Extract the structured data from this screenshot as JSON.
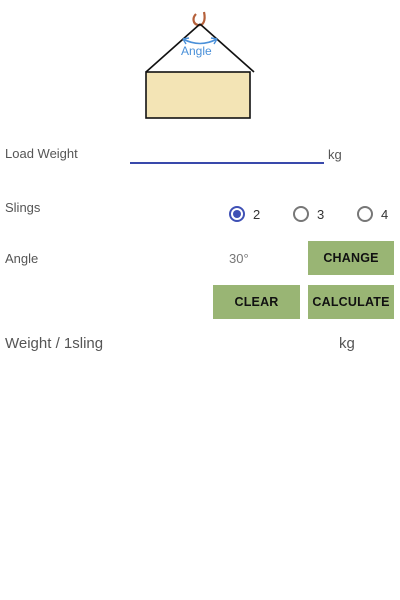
{
  "diagram": {
    "angle_label": "Angle"
  },
  "load_weight": {
    "label": "Load Weight",
    "value": "",
    "unit": "kg"
  },
  "slings": {
    "label": "Slings",
    "options": [
      {
        "label": "2",
        "checked": true
      },
      {
        "label": "3",
        "checked": false
      },
      {
        "label": "4",
        "checked": false
      }
    ]
  },
  "angle": {
    "label": "Angle",
    "value": "30°",
    "change_label": "CHANGE"
  },
  "actions": {
    "clear_label": "CLEAR",
    "calculate_label": "CALCULATE"
  },
  "result": {
    "label": "Weight / 1sling",
    "value": "",
    "unit": "kg"
  },
  "colors": {
    "accent": "#3f51b5",
    "button": "#99b574",
    "load_box": "#f3e4b5",
    "hook": "#b5603a",
    "angle_arc": "#4a90d9"
  }
}
